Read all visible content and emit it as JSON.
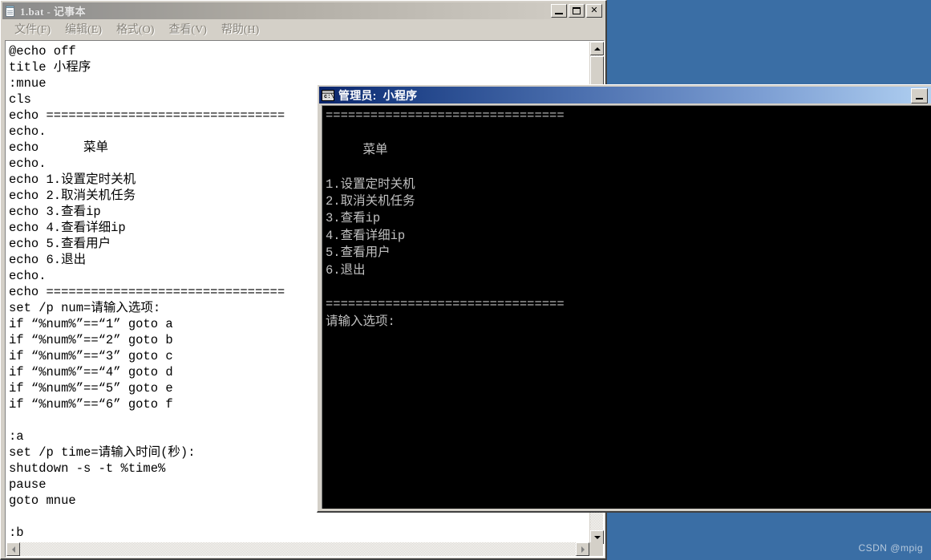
{
  "desktop": {
    "background_color": "#3a6ea5",
    "watermark": "CSDN @mpig"
  },
  "notepad": {
    "icon": "notepad-icon",
    "title": "1.bat - 记事本",
    "window_buttons": [
      {
        "name": "minimize-button",
        "label": ""
      },
      {
        "name": "maximize-button",
        "label": ""
      },
      {
        "name": "close-button",
        "label": "✕"
      }
    ],
    "menu": [
      {
        "label": "文件(F)"
      },
      {
        "label": "编辑(E)"
      },
      {
        "label": "格式(O)"
      },
      {
        "label": "查看(V)"
      },
      {
        "label": "帮助(H)"
      }
    ],
    "content": "@echo off\ntitle 小程序\n:mnue\ncls\necho ================================\necho.\necho      菜单\necho.\necho 1.设置定时关机\necho 2.取消关机任务\necho 3.查看ip\necho 4.查看详细ip\necho 5.查看用户\necho 6.退出\necho.\necho ================================\nset /p num=请输入选项:\nif “%num%”==“1” goto a\nif “%num%”==“2” goto b\nif “%num%”==“3” goto c\nif “%num%”==“4” goto d\nif “%num%”==“5” goto e\nif “%num%”==“6” goto f\n\n:a\nset /p time=请输入时间(秒):\nshutdown -s -t %time%\npause\ngoto mnue\n\n:b"
  },
  "console": {
    "icon": "console-icon",
    "title": "管理员:  小程序",
    "window_buttons": [
      {
        "name": "minimize-button",
        "label": ""
      }
    ],
    "content": "================================\n\n     菜单\n\n1.设置定时关机\n2.取消关机任务\n3.查看ip\n4.查看详细ip\n5.查看用户\n6.退出\n\n================================\n请输入选项:",
    "foreground_color": "#c0c0c0",
    "background_color": "#000000"
  }
}
